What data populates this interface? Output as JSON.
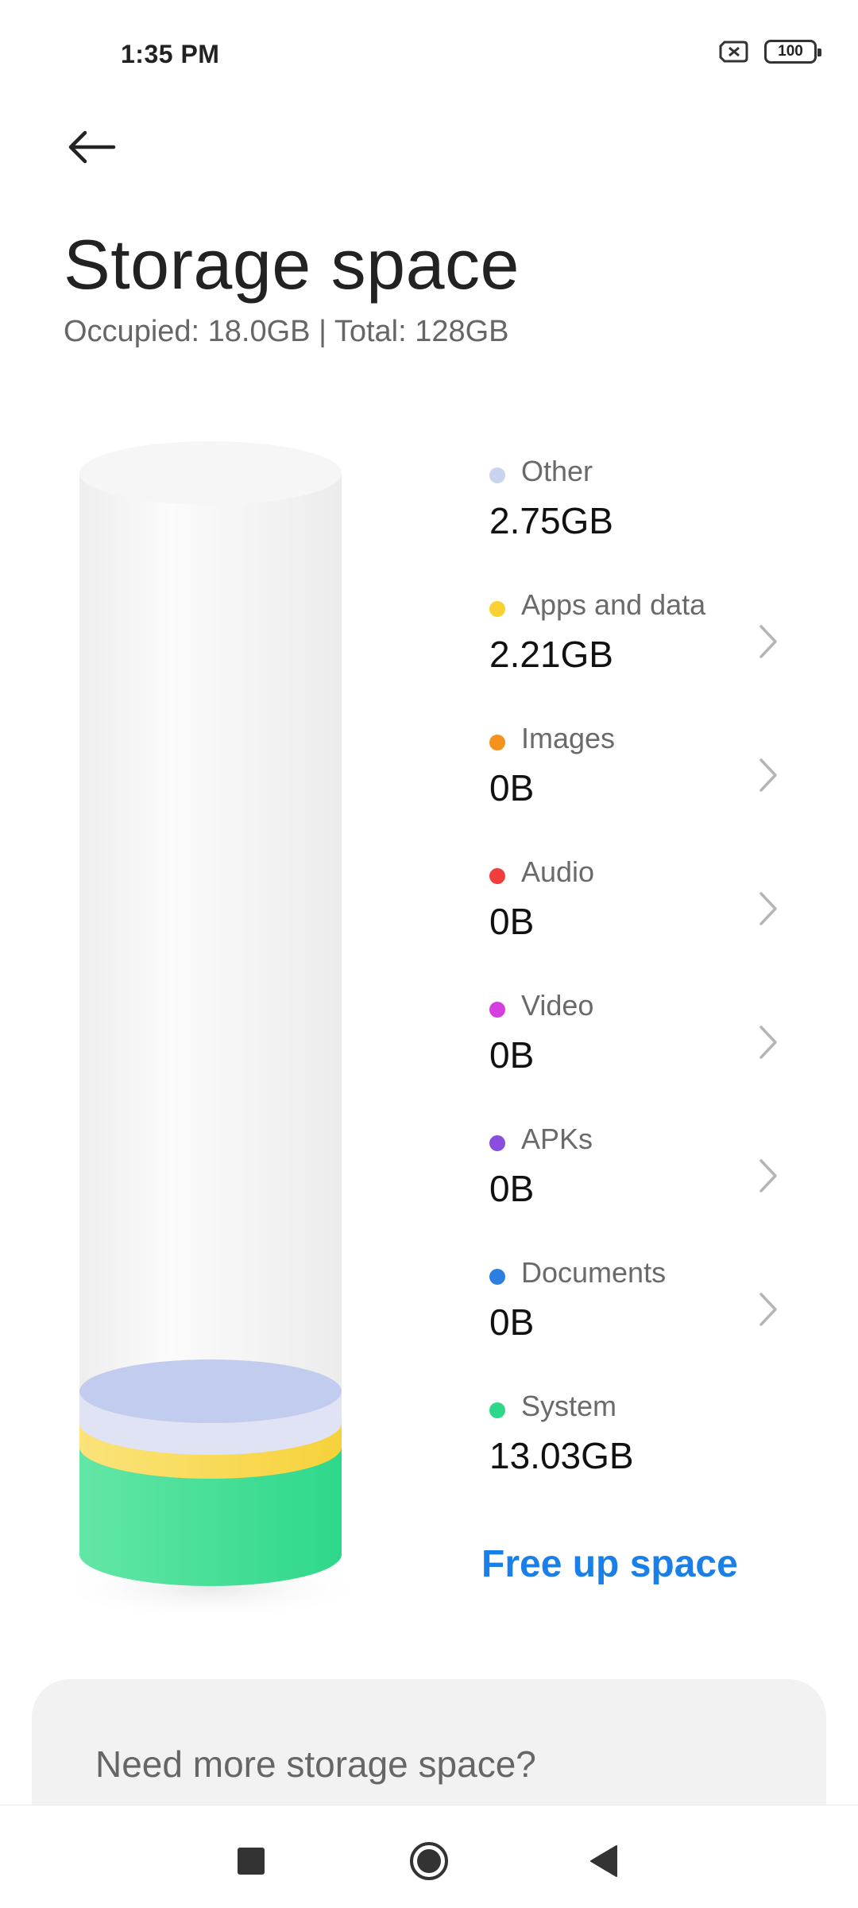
{
  "status_bar": {
    "time": "1:35 PM",
    "battery_level": "100"
  },
  "header": {
    "title": "Storage space",
    "subtitle": "Occupied: 18.0GB | Total: 128GB"
  },
  "storage_categories": [
    {
      "label": "Other",
      "value": "2.75GB",
      "color": "#c9d3ee",
      "has_chevron": false
    },
    {
      "label": "Apps and data",
      "value": "2.21GB",
      "color": "#f7d232",
      "has_chevron": true
    },
    {
      "label": "Images",
      "value": "0B",
      "color": "#f5921e",
      "has_chevron": true
    },
    {
      "label": "Audio",
      "value": "0B",
      "color": "#f23d3d",
      "has_chevron": true
    },
    {
      "label": "Video",
      "value": "0B",
      "color": "#d63ee0",
      "has_chevron": true
    },
    {
      "label": "APKs",
      "value": "0B",
      "color": "#8a4de0",
      "has_chevron": true
    },
    {
      "label": "Documents",
      "value": "0B",
      "color": "#2b7fe0",
      "has_chevron": true
    },
    {
      "label": "System",
      "value": "13.03GB",
      "color": "#2ed88a",
      "has_chevron": false
    }
  ],
  "actions": {
    "free_up_label": "Free up space"
  },
  "promo": {
    "text": "Need more storage space?"
  },
  "icons": {
    "back": "back-arrow-icon",
    "chevron": "chevron-right-icon",
    "sim": "no-sim-icon",
    "battery": "battery-icon",
    "nav_recent": "square-icon",
    "nav_home": "circle-icon",
    "nav_back": "triangle-icon"
  }
}
